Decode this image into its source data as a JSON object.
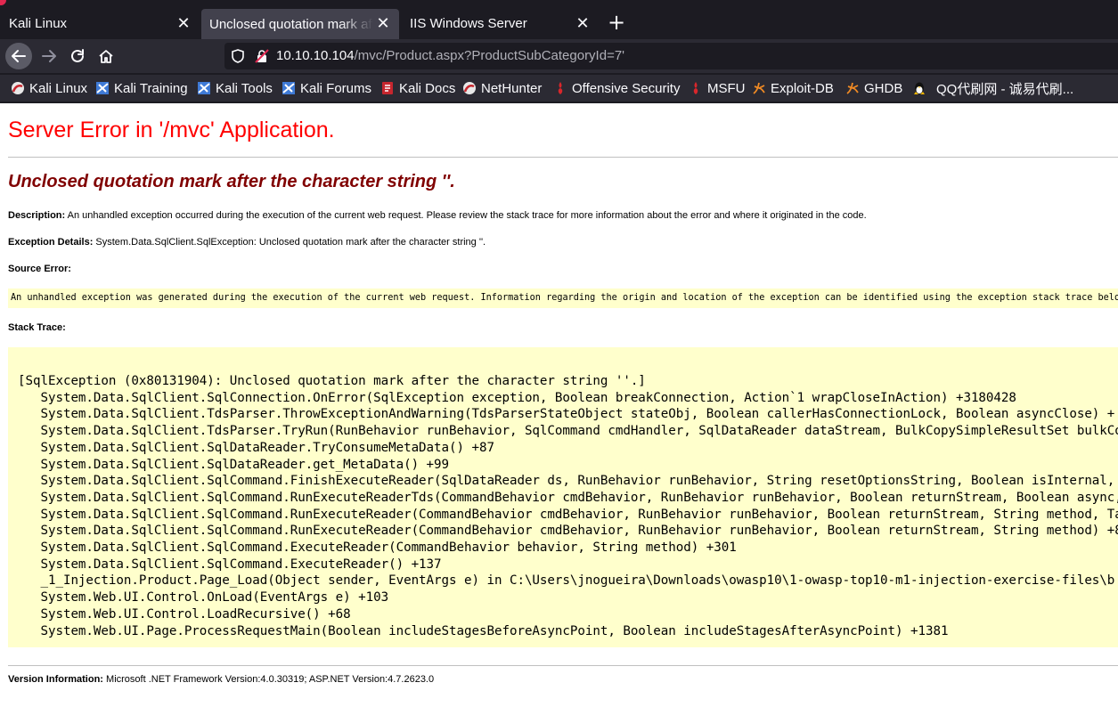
{
  "browser": {
    "tabs": [
      {
        "title": "Kali Linux",
        "active": false
      },
      {
        "title": "Unclosed quotation mark after the character string",
        "active": true
      },
      {
        "title": "IIS Windows Server",
        "active": false
      }
    ],
    "new_tab_icon": "plus-icon",
    "url": {
      "host": "10.10.10.104",
      "path": "/mvc/Product.aspx?ProductSubCategoryId=7'"
    },
    "bookmarks": [
      {
        "label": "Kali Linux",
        "icon": "kali-dragon-icon"
      },
      {
        "label": "Kali Training",
        "icon": "kali-training-icon"
      },
      {
        "label": "Kali Tools",
        "icon": "kali-tools-icon"
      },
      {
        "label": "Kali Forums",
        "icon": "kali-forums-icon"
      },
      {
        "label": "Kali Docs",
        "icon": "kali-docs-icon"
      },
      {
        "label": "NetHunter",
        "icon": "nethunter-icon"
      },
      {
        "label": "Offensive Security",
        "icon": "offsec-icon"
      },
      {
        "label": "MSFU",
        "icon": "msfu-icon"
      },
      {
        "label": "Exploit-DB",
        "icon": "exploit-db-icon"
      },
      {
        "label": "GHDB",
        "icon": "ghdb-icon"
      },
      {
        "label": "QQ代刷网 - 诚易代刷...",
        "icon": "qq-penguin-icon"
      }
    ],
    "colors": {
      "chrome_dark": "#1c1b22",
      "toolbar": "#2b2a33",
      "active_tab": "#42414d"
    }
  },
  "page": {
    "title": "Server Error in '/mvc' Application.",
    "subtitle": "Unclosed quotation mark after the character string ''.",
    "description_label": "Description:",
    "description_text": " An unhandled exception occurred during the execution of the current web request. Please review the stack trace for more information about the error and where it originated in the code.",
    "exception_label": "Exception Details:",
    "exception_text": " System.Data.SqlClient.SqlException: Unclosed quotation mark after the character string ''.",
    "source_error_label": "Source Error:",
    "source_error_text": "An unhandled exception was generated during the execution of the current web request. Information regarding the origin and location of the exception can be identified using the exception stack trace below.",
    "stack_trace_label": "Stack Trace:",
    "stack_trace": [
      "[SqlException (0x80131904): Unclosed quotation mark after the character string ''.]",
      "   System.Data.SqlClient.SqlConnection.OnError(SqlException exception, Boolean breakConnection, Action`1 wrapCloseInAction) +3180428",
      "   System.Data.SqlClient.TdsParser.ThrowExceptionAndWarning(TdsParserStateObject stateObj, Boolean callerHasConnectionLock, Boolean asyncClose) +",
      "   System.Data.SqlClient.TdsParser.TryRun(RunBehavior runBehavior, SqlCommand cmdHandler, SqlDataReader dataStream, BulkCopySimpleResultSet bulkCo",
      "   System.Data.SqlClient.SqlDataReader.TryConsumeMetaData() +87",
      "   System.Data.SqlClient.SqlDataReader.get_MetaData() +99",
      "   System.Data.SqlClient.SqlCommand.FinishExecuteReader(SqlDataReader ds, RunBehavior runBehavior, String resetOptionsString, Boolean isInternal, ",
      "   System.Data.SqlClient.SqlCommand.RunExecuteReaderTds(CommandBehavior cmdBehavior, RunBehavior runBehavior, Boolean returnStream, Boolean async,",
      "   System.Data.SqlClient.SqlCommand.RunExecuteReader(CommandBehavior cmdBehavior, RunBehavior runBehavior, Boolean returnStream, String method, Ta",
      "   System.Data.SqlClient.SqlCommand.RunExecuteReader(CommandBehavior cmdBehavior, RunBehavior runBehavior, Boolean returnStream, String method) +8",
      "   System.Data.SqlClient.SqlCommand.ExecuteReader(CommandBehavior behavior, String method) +301",
      "   System.Data.SqlClient.SqlCommand.ExecuteReader() +137",
      "   _1_Injection.Product.Page_Load(Object sender, EventArgs e) in C:\\Users\\jnogueira\\Downloads\\owasp10\\1-owasp-top10-m1-injection-exercise-files\\b",
      "   System.Web.UI.Control.OnLoad(EventArgs e) +103",
      "   System.Web.UI.Control.LoadRecursive() +68",
      "   System.Web.UI.Page.ProcessRequestMain(Boolean includeStagesBeforeAsyncPoint, Boolean includeStagesAfterAsyncPoint) +1381"
    ],
    "version_label": "Version Information:",
    "version_text": " Microsoft .NET Framework Version:4.0.30319; ASP.NET Version:4.7.2623.0",
    "colors": {
      "title": "#ff0000",
      "subtitle": "#800000",
      "code_bg": "#ffffcc"
    }
  }
}
